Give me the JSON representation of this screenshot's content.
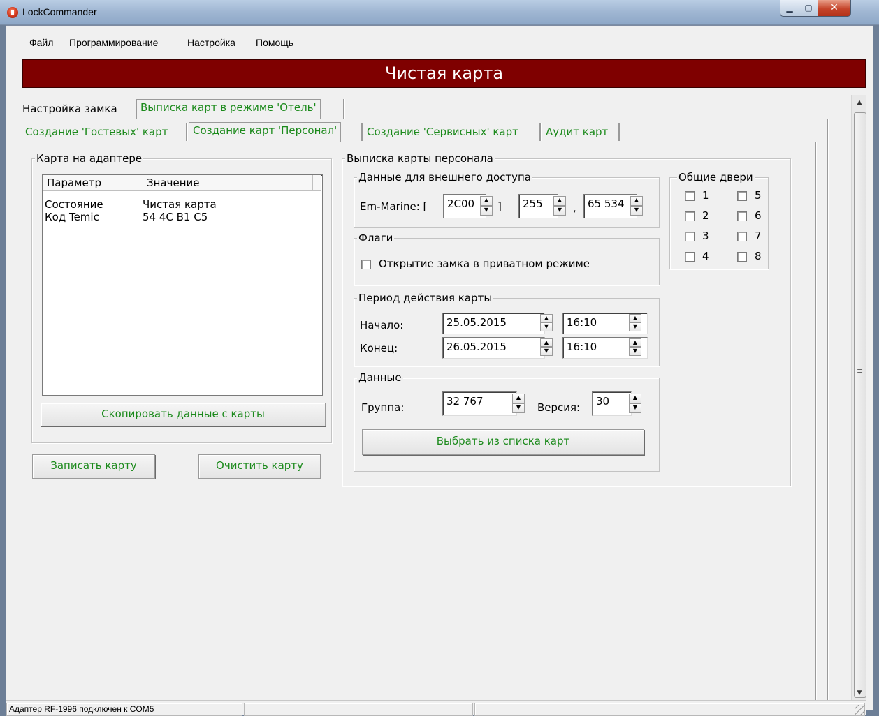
{
  "window": {
    "title": "LockCommander",
    "close_glyph": "✕",
    "min_glyph": "▁",
    "max_glyph": "▢"
  },
  "menu": {
    "items": [
      "Файл",
      "Программирование",
      "Настройка",
      "Помощь"
    ]
  },
  "banner": {
    "text": "Чистая карта",
    "color": "#7f0000"
  },
  "tabs_top": [
    "Настройка замка",
    "Выписка карт в режиме 'Отель'"
  ],
  "tabs_sub": [
    "Создание 'Гостевых' карт",
    "Создание карт 'Персонал'",
    "Создание 'Сервисных' карт",
    "Аудит карт"
  ],
  "card_on_adapter": {
    "legend": "Карта на адаптере",
    "columns": [
      "Параметр",
      "Значение"
    ],
    "rows": [
      {
        "param": "Состояние",
        "value": "Чистая карта"
      },
      {
        "param": "Код Temic",
        "value": "54 4C B1 C5"
      }
    ],
    "copy_button": "Скопировать данные с карты"
  },
  "actions": {
    "write_card": "Записать карту",
    "clear_card": "Очистить карту"
  },
  "staff_card": {
    "legend": "Выписка карты персонала",
    "external_access": {
      "legend": "Данные для внешнего доступа",
      "em_marine_label": "Em-Marine: [",
      "bracket_close": "]",
      "comma": ",",
      "field1": "2C00",
      "field2": "255",
      "field3": "65 534"
    },
    "flags": {
      "legend": "Флаги",
      "private_mode": "Открытие замка в приватном режиме",
      "private_mode_checked": false
    },
    "validity": {
      "legend": "Период действия карты",
      "start_label": "Начало:",
      "start_date": "25.05.2015",
      "start_time": "16:10",
      "end_label": "Конец:",
      "end_date": "26.05.2015",
      "end_time": "16:10"
    },
    "data": {
      "legend": "Данные",
      "group_label": "Группа:",
      "group_value": "32 767",
      "version_label": "Версия:",
      "version_value": "30",
      "select_button": "Выбрать из списка карт"
    },
    "common_doors": {
      "legend": "Общие двери",
      "doors": [
        "1",
        "2",
        "3",
        "4",
        "5",
        "6",
        "7",
        "8"
      ]
    }
  },
  "statusbar": {
    "adapter": "Адаптер RF-1996 подключен к COM5",
    "panel2": "",
    "panel3": ""
  },
  "colors": {
    "accent_green": "#1c8a1c",
    "banner": "#7f0000",
    "background": "#f0f0f0"
  }
}
